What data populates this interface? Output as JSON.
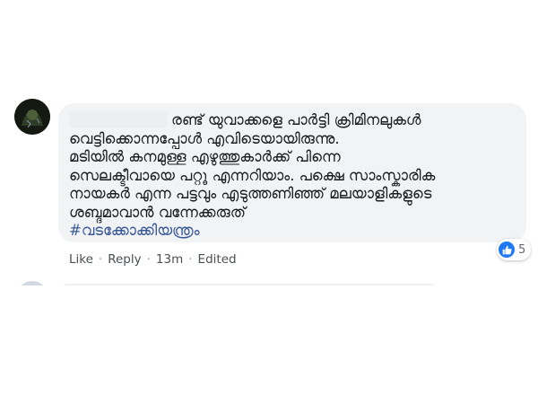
{
  "comment": {
    "lines": [
      "രണ്ട് യുവാക്കളെ പാർട്ടി ക്രിമിനലുകൾ",
      "വെട്ടിക്കൊന്നപ്പോൾ എവിടെയായിരുന്നു.",
      "മടിയിൽ കനമുള്ള എഴുത്തുകാർക്ക് പിന്നെ",
      "സെലക്ടീവായെ പറ്റൂ എന്നറിയാം. പക്ഷെ സാംസ്കാരിക",
      "നായകർ എന്ന പട്ടവും എടുത്തണിഞ്ഞ് മലയാളികളുടെ",
      "ശബ്ദമാവാൻ വന്നേക്കരുത്"
    ],
    "hashtag": "#വടക്കോക്കിയന്ത്രം",
    "reaction_icon": "like-icon",
    "reaction_count": "5"
  },
  "actions": {
    "like": "Like",
    "reply": "Reply",
    "time": "13m",
    "edited": "Edited",
    "separator": "·"
  },
  "colors": {
    "bubble": "#f2f3f5",
    "text": "#1c1e21",
    "hashtag": "#385898",
    "like_blue": "#2078f4",
    "meta": "#606770"
  }
}
